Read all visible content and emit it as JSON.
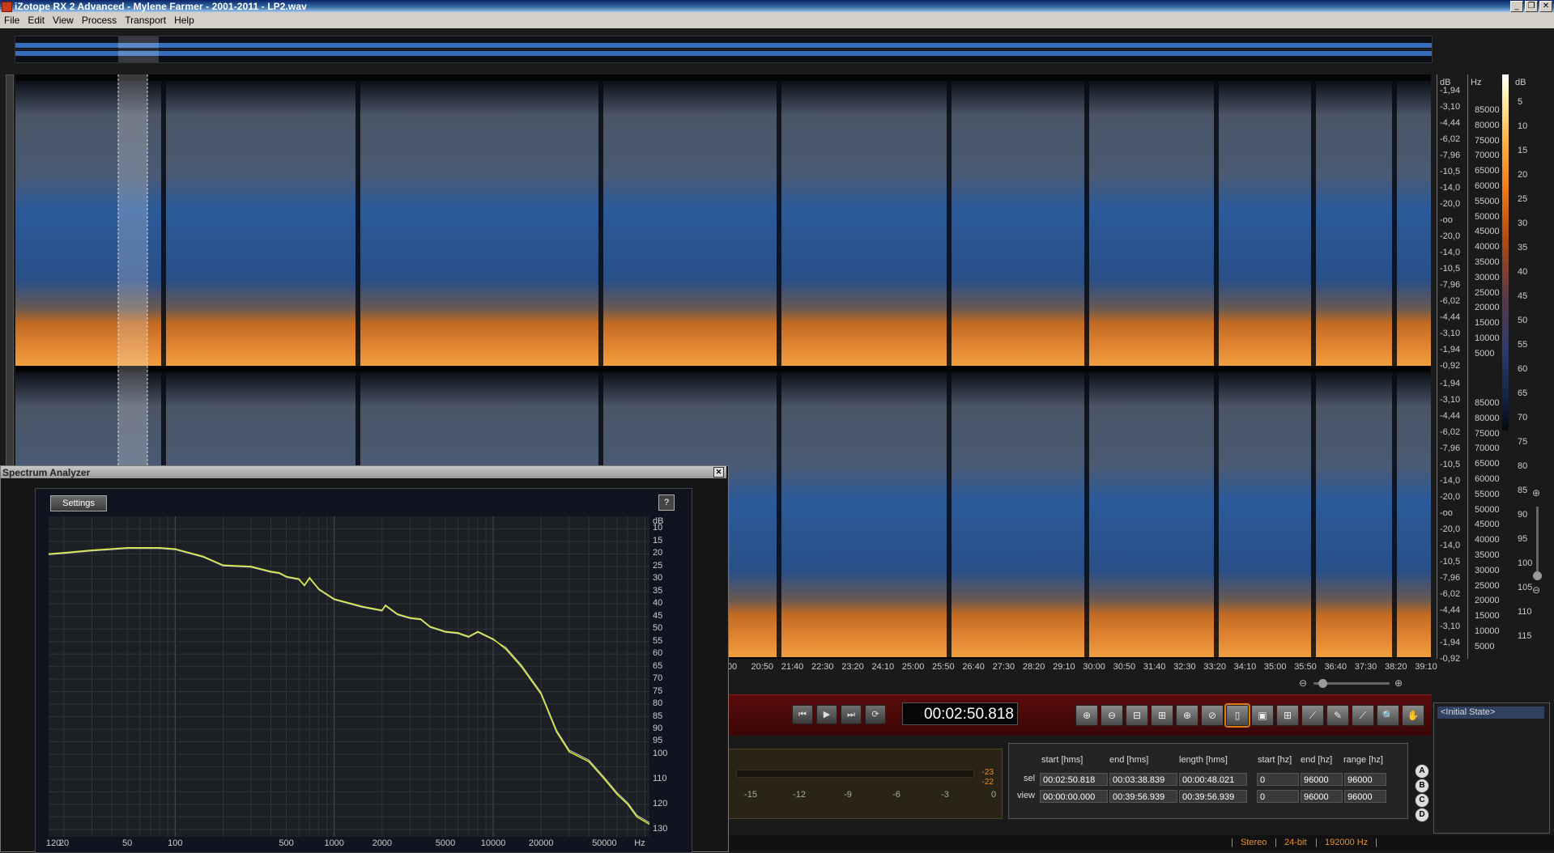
{
  "window": {
    "title": "iZotope RX 2 Advanced - Mylene Farmer - 2001-2011 - LP2.wav",
    "buttons": [
      "_",
      "❐",
      "✕"
    ]
  },
  "menu": [
    "File",
    "Edit",
    "View",
    "Process",
    "Transport",
    "Help"
  ],
  "spectrogram": {
    "db_unit": "dB",
    "hz_unit": "Hz",
    "cb_unit": "dB",
    "channel_db_ticks": [
      "-1,94",
      "-3,10",
      "-4,44",
      "-6,02",
      "-7,96",
      "-10,5",
      "-14,0",
      "-20,0",
      "-oo",
      "-20,0",
      "-14,0",
      "-10,5",
      "-7,96",
      "-6,02",
      "-4,44",
      "-3,10",
      "-1,94",
      "-0,92"
    ],
    "channel_hz_ticks": [
      "85000",
      "80000",
      "75000",
      "70000",
      "65000",
      "60000",
      "55000",
      "50000",
      "45000",
      "40000",
      "35000",
      "30000",
      "25000",
      "20000",
      "15000",
      "10000",
      "5000"
    ],
    "colorbar_ticks": [
      "5",
      "10",
      "15",
      "20",
      "25",
      "30",
      "35",
      "40",
      "45",
      "50",
      "55",
      "60",
      "65",
      "70",
      "75",
      "80",
      "85",
      "90",
      "95",
      "100",
      "105",
      "110",
      "115"
    ],
    "time_ticks": [
      "00",
      "20:50",
      "21:40",
      "22:30",
      "23:20",
      "24:10",
      "25:00",
      "25:50",
      "26:40",
      "27:30",
      "28:20",
      "29:10",
      "30:00",
      "30:50",
      "31:40",
      "32:30",
      "33:20",
      "34:10",
      "35:00",
      "35:50",
      "36:40",
      "37:30",
      "38:20",
      "39:10"
    ]
  },
  "transport": {
    "buttons": {
      "rewind": "⏮",
      "play": "▶",
      "play_sel": "⏭",
      "loop": "⟳"
    },
    "timecode": "00:02:50.818",
    "tools": [
      "⊕",
      "⊖",
      "⊟",
      "⊞",
      "⊕",
      "⊘",
      "▯",
      "▣",
      "⊞",
      "⟋",
      "✎",
      "⟋",
      "🔍",
      "✋"
    ]
  },
  "meter": {
    "ticks": [
      "-15",
      "-12",
      "-9",
      "-6",
      "-3",
      "0"
    ],
    "peak_top": "-23",
    "peak_bottom": "-22"
  },
  "selection": {
    "headers": [
      "start [hms]",
      "end [hms]",
      "length [hms]",
      "start [hz]",
      "end [hz]",
      "range [hz]"
    ],
    "rows": [
      {
        "label": "sel",
        "values": [
          "00:02:50.818",
          "00:03:38.839",
          "00:00:48.021",
          "0",
          "96000",
          "96000"
        ]
      },
      {
        "label": "view",
        "values": [
          "00:00:00.000",
          "00:39:56.939",
          "00:39:56.939",
          "0",
          "96000",
          "96000"
        ]
      }
    ]
  },
  "snapshots": [
    "A",
    "B",
    "C",
    "D"
  ],
  "history": {
    "items": [
      "<Initial State>"
    ]
  },
  "status": {
    "channels": "Stereo",
    "bits": "24-bit",
    "rate": "192000 Hz"
  },
  "spectrum_analyzer": {
    "title": "Spectrum Analyzer",
    "close": "✕",
    "settings_label": "Settings",
    "help_label": "?",
    "db_unit": "dB",
    "db_ticks": [
      "10",
      "15",
      "20",
      "25",
      "30",
      "35",
      "40",
      "45",
      "50",
      "55",
      "60",
      "65",
      "70",
      "75",
      "80",
      "85",
      "90",
      "95",
      "100",
      "110",
      "120",
      "130"
    ],
    "freq_ticks": [
      "120",
      "20",
      "50",
      "100",
      "500",
      "1000",
      "2000",
      "5000",
      "10000",
      "20000",
      "50000",
      "Hz"
    ],
    "colors": {
      "line_primary": "#d4e83a",
      "line_secondary": "#ffffff"
    }
  },
  "chart_data": {
    "type": "line",
    "xlabel": "Hz",
    "ylabel": "dB",
    "x_scale": "log",
    "xlim": [
      16,
      96000
    ],
    "ylim": [
      5,
      133
    ],
    "series": [
      {
        "x": [
          16,
          20,
          30,
          50,
          80,
          100,
          150,
          200,
          300,
          400,
          450,
          500,
          600,
          650,
          700,
          800,
          1000,
          1500,
          2000,
          2100,
          2500,
          3000,
          3500,
          4000,
          5000,
          6000,
          7000,
          8000,
          10000,
          12000,
          15000,
          20000,
          25000,
          30000,
          40000,
          50000,
          60000,
          70000,
          80000,
          96000
        ],
        "values": [
          20,
          19.5,
          18.5,
          17.5,
          17.5,
          18,
          21,
          24.5,
          25,
          27,
          27.5,
          29,
          30,
          32.5,
          29.5,
          34,
          38,
          41,
          42.5,
          40.5,
          44,
          45.5,
          46,
          49,
          51,
          51.5,
          53,
          51,
          54,
          58,
          65,
          76,
          91,
          99,
          103,
          110,
          116,
          120,
          125,
          128
        ]
      }
    ]
  }
}
